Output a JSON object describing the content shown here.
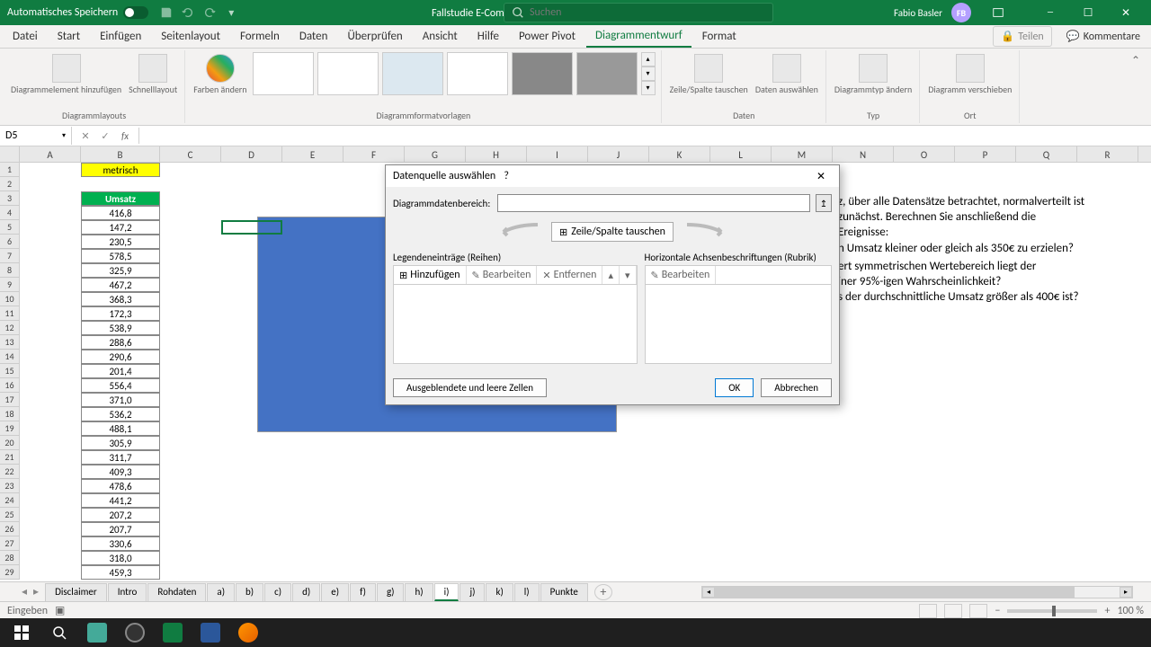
{
  "titlebar": {
    "autosave": "Automatisches Speichern",
    "filename": "Fallstudie E-Commerce Webshop",
    "search_placeholder": "Suchen",
    "user": "Fabio Basler",
    "initials": "FB"
  },
  "tabs": {
    "file": "Datei",
    "home": "Start",
    "insert": "Einfügen",
    "page": "Seitenlayout",
    "formulas": "Formeln",
    "data": "Daten",
    "review": "Überprüfen",
    "view": "Ansicht",
    "help": "Hilfe",
    "powerpivot": "Power Pivot",
    "chartdesign": "Diagrammentwurf",
    "format": "Format",
    "share": "Teilen",
    "comments": "Kommentare"
  },
  "ribbon": {
    "add_element": "Diagrammelement\nhinzufügen",
    "quick_layout": "Schnelllayout",
    "colors": "Farben\nändern",
    "styles_group": "Diagrammformatvorlagen",
    "layouts_group": "Diagrammlayouts",
    "switch_rc": "Zeile/Spalte\ntauschen",
    "select_data": "Daten\nauswählen",
    "data_group": "Daten",
    "change_type": "Diagrammtyp\nändern",
    "type_group": "Typ",
    "move_chart": "Diagramm\nverschieben",
    "loc_group": "Ort"
  },
  "namebox": "D5",
  "columns": [
    "A",
    "B",
    "C",
    "D",
    "E",
    "F",
    "G",
    "H",
    "I",
    "J",
    "K",
    "L",
    "M",
    "N",
    "O",
    "P",
    "Q",
    "R"
  ],
  "rows": [
    "1",
    "2",
    "3",
    "4",
    "5",
    "6",
    "7",
    "8",
    "9",
    "10",
    "11",
    "12",
    "13",
    "14",
    "15",
    "16",
    "17",
    "18",
    "19",
    "20",
    "21",
    "22",
    "23",
    "24",
    "25",
    "26",
    "27",
    "28",
    "29"
  ],
  "b1": "metrisch",
  "b3": "Umsatz",
  "bvals": [
    "416,8",
    "147,2",
    "230,5",
    "578,5",
    "325,9",
    "467,2",
    "368,3",
    "172,3",
    "538,9",
    "288,6",
    "290,6",
    "201,4",
    "556,4",
    "371,0",
    "536,2",
    "488,1",
    "305,9",
    "311,7",
    "409,3",
    "478,6",
    "441,2",
    "207,2",
    "207,7",
    "330,6",
    "318,0",
    "459,3"
  ],
  "text1": "z, über alle Datensätze betrachtet, normalverteilt ist\nzunächst. Berechnen Sie anschließend die\nEreignisse:",
  "text2": "n Umsatz kleiner oder gleich als 350€ zu erzielen?",
  "text3": "ert symmetrischen Wertebereich liegt der\niner 95%-igen Wahrscheinlichkeit?",
  "text4": "s der durchschnittliche Umsatz größer als 400€ ist?",
  "dialog": {
    "title": "Datenquelle auswählen",
    "range_label": "Diagrammdatenbereich:",
    "switch": "Zeile/Spalte tauschen",
    "legend": "Legendeneinträge (Reihen)",
    "axis": "Horizontale Achsenbeschriftungen (Rubrik)",
    "add": "Hinzufügen",
    "edit": "Bearbeiten",
    "remove": "Entfernen",
    "hidden": "Ausgeblendete und leere Zellen",
    "ok": "OK",
    "cancel": "Abbrechen"
  },
  "sheets": [
    "Disclaimer",
    "Intro",
    "Rohdaten",
    "a)",
    "b)",
    "c)",
    "d)",
    "e)",
    "f)",
    "g)",
    "h)",
    "i)",
    "j)",
    "k)",
    "l)",
    "Punkte"
  ],
  "active_sheet": "i)",
  "status": "Eingeben",
  "zoom": "100 %"
}
